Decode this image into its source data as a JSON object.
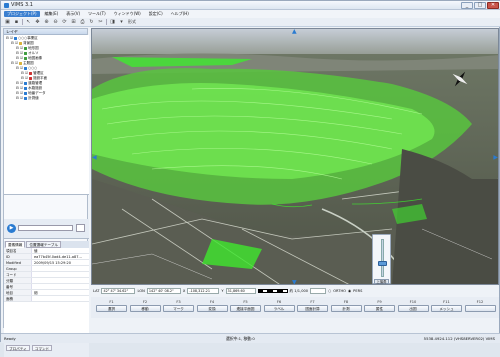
{
  "window": {
    "title": "VIMS 3.1",
    "buttons": [
      "_",
      "□",
      "✕"
    ]
  },
  "menu": {
    "items": [
      "プロジェクト(P)",
      "編集(E)",
      "表示(V)",
      "ツール(T)",
      "ウィンドウ(W)",
      "設定(C)",
      "ヘルプ(H)"
    ],
    "active_index": 0
  },
  "toolbar": {
    "label": "形式"
  },
  "left_panel": {
    "header": "レイヤ",
    "tree": [
      {
        "label": "○○○事業区",
        "indent": 0,
        "color": "#2a7bd1"
      },
      {
        "label": "背景図",
        "indent": 1,
        "color": "#d9b23b"
      },
      {
        "label": "地形図",
        "indent": 2,
        "color": "#3f9c3f"
      },
      {
        "label": "オルソ",
        "indent": 2,
        "color": "#3f9c3f"
      },
      {
        "label": "地図画像",
        "indent": 2,
        "color": "#3f9c3f"
      },
      {
        "label": "主題図",
        "indent": 1,
        "color": "#d9b23b"
      },
      {
        "label": "○○○",
        "indent": 2,
        "color": "#2a7bd1"
      },
      {
        "label": "管理区",
        "indent": 3,
        "color": "#c33"
      },
      {
        "label": "施設平面",
        "indent": 3,
        "color": "#c33"
      },
      {
        "label": "道路管理",
        "indent": 2,
        "color": "#2a7bd1"
      },
      {
        "label": "水路施設",
        "indent": 2,
        "color": "#2a7bd1"
      },
      {
        "label": "地番データ",
        "indent": 2,
        "color": "#2a7bd1"
      },
      {
        "label": "計測値",
        "indent": 2,
        "color": "#2a7bd1"
      }
    ],
    "tabs": [
      "要素情報",
      "位置選報テーブル"
    ],
    "properties": [
      {
        "key": "項目名",
        "value": "値"
      },
      {
        "key": "ID",
        "value": "ea77b45f-0ad4-de11-a87..."
      },
      {
        "key": "Modified",
        "value": "2009/09/15 15:29:20"
      },
      {
        "key": "Group",
        "value": ""
      },
      {
        "key": "コード",
        "value": ""
      },
      {
        "key": "分類",
        "value": ""
      },
      {
        "key": "番号",
        "value": ""
      },
      {
        "key": "地目",
        "value": "畑"
      },
      {
        "key": "面積",
        "value": ""
      }
    ],
    "bottom_tabs": [
      "プロパティ",
      "コマンド"
    ]
  },
  "map": {
    "rotation_label": "上撮角"
  },
  "coordbar": {
    "lat_label": "LAT",
    "lat_value": "42° 47' 34.62\"",
    "lon_label": "LON",
    "lon_value": "142° 40' 08.2\"",
    "x_label": "X",
    "x_value": "-108,312.21",
    "y_label": "Y",
    "y_value": "31,869.60",
    "scale_value": "約 1/1,000",
    "ortho_label": "ORTHO",
    "pers_label": "PERS"
  },
  "fkeys": [
    {
      "key": "F1",
      "label": "選択"
    },
    {
      "key": "F2",
      "label": "移動"
    },
    {
      "key": "F3",
      "label": "マーク"
    },
    {
      "key": "F4",
      "label": "変換"
    },
    {
      "key": "F5",
      "label": "連接平面図"
    },
    {
      "key": "F6",
      "label": "ラベル"
    },
    {
      "key": "F7",
      "label": "図面計算"
    },
    {
      "key": "F8",
      "label": "計測"
    },
    {
      "key": "F9",
      "label": "属性"
    },
    {
      "key": "F10",
      "label": "出図"
    },
    {
      "key": "F11",
      "label": "メッシュ"
    },
    {
      "key": "F12",
      "label": ""
    }
  ],
  "status": {
    "ready": "Ready",
    "mid": "選択中:1, 移動:0",
    "right": "5538.4924.112 (VHS8ERVER02) VIMS"
  }
}
